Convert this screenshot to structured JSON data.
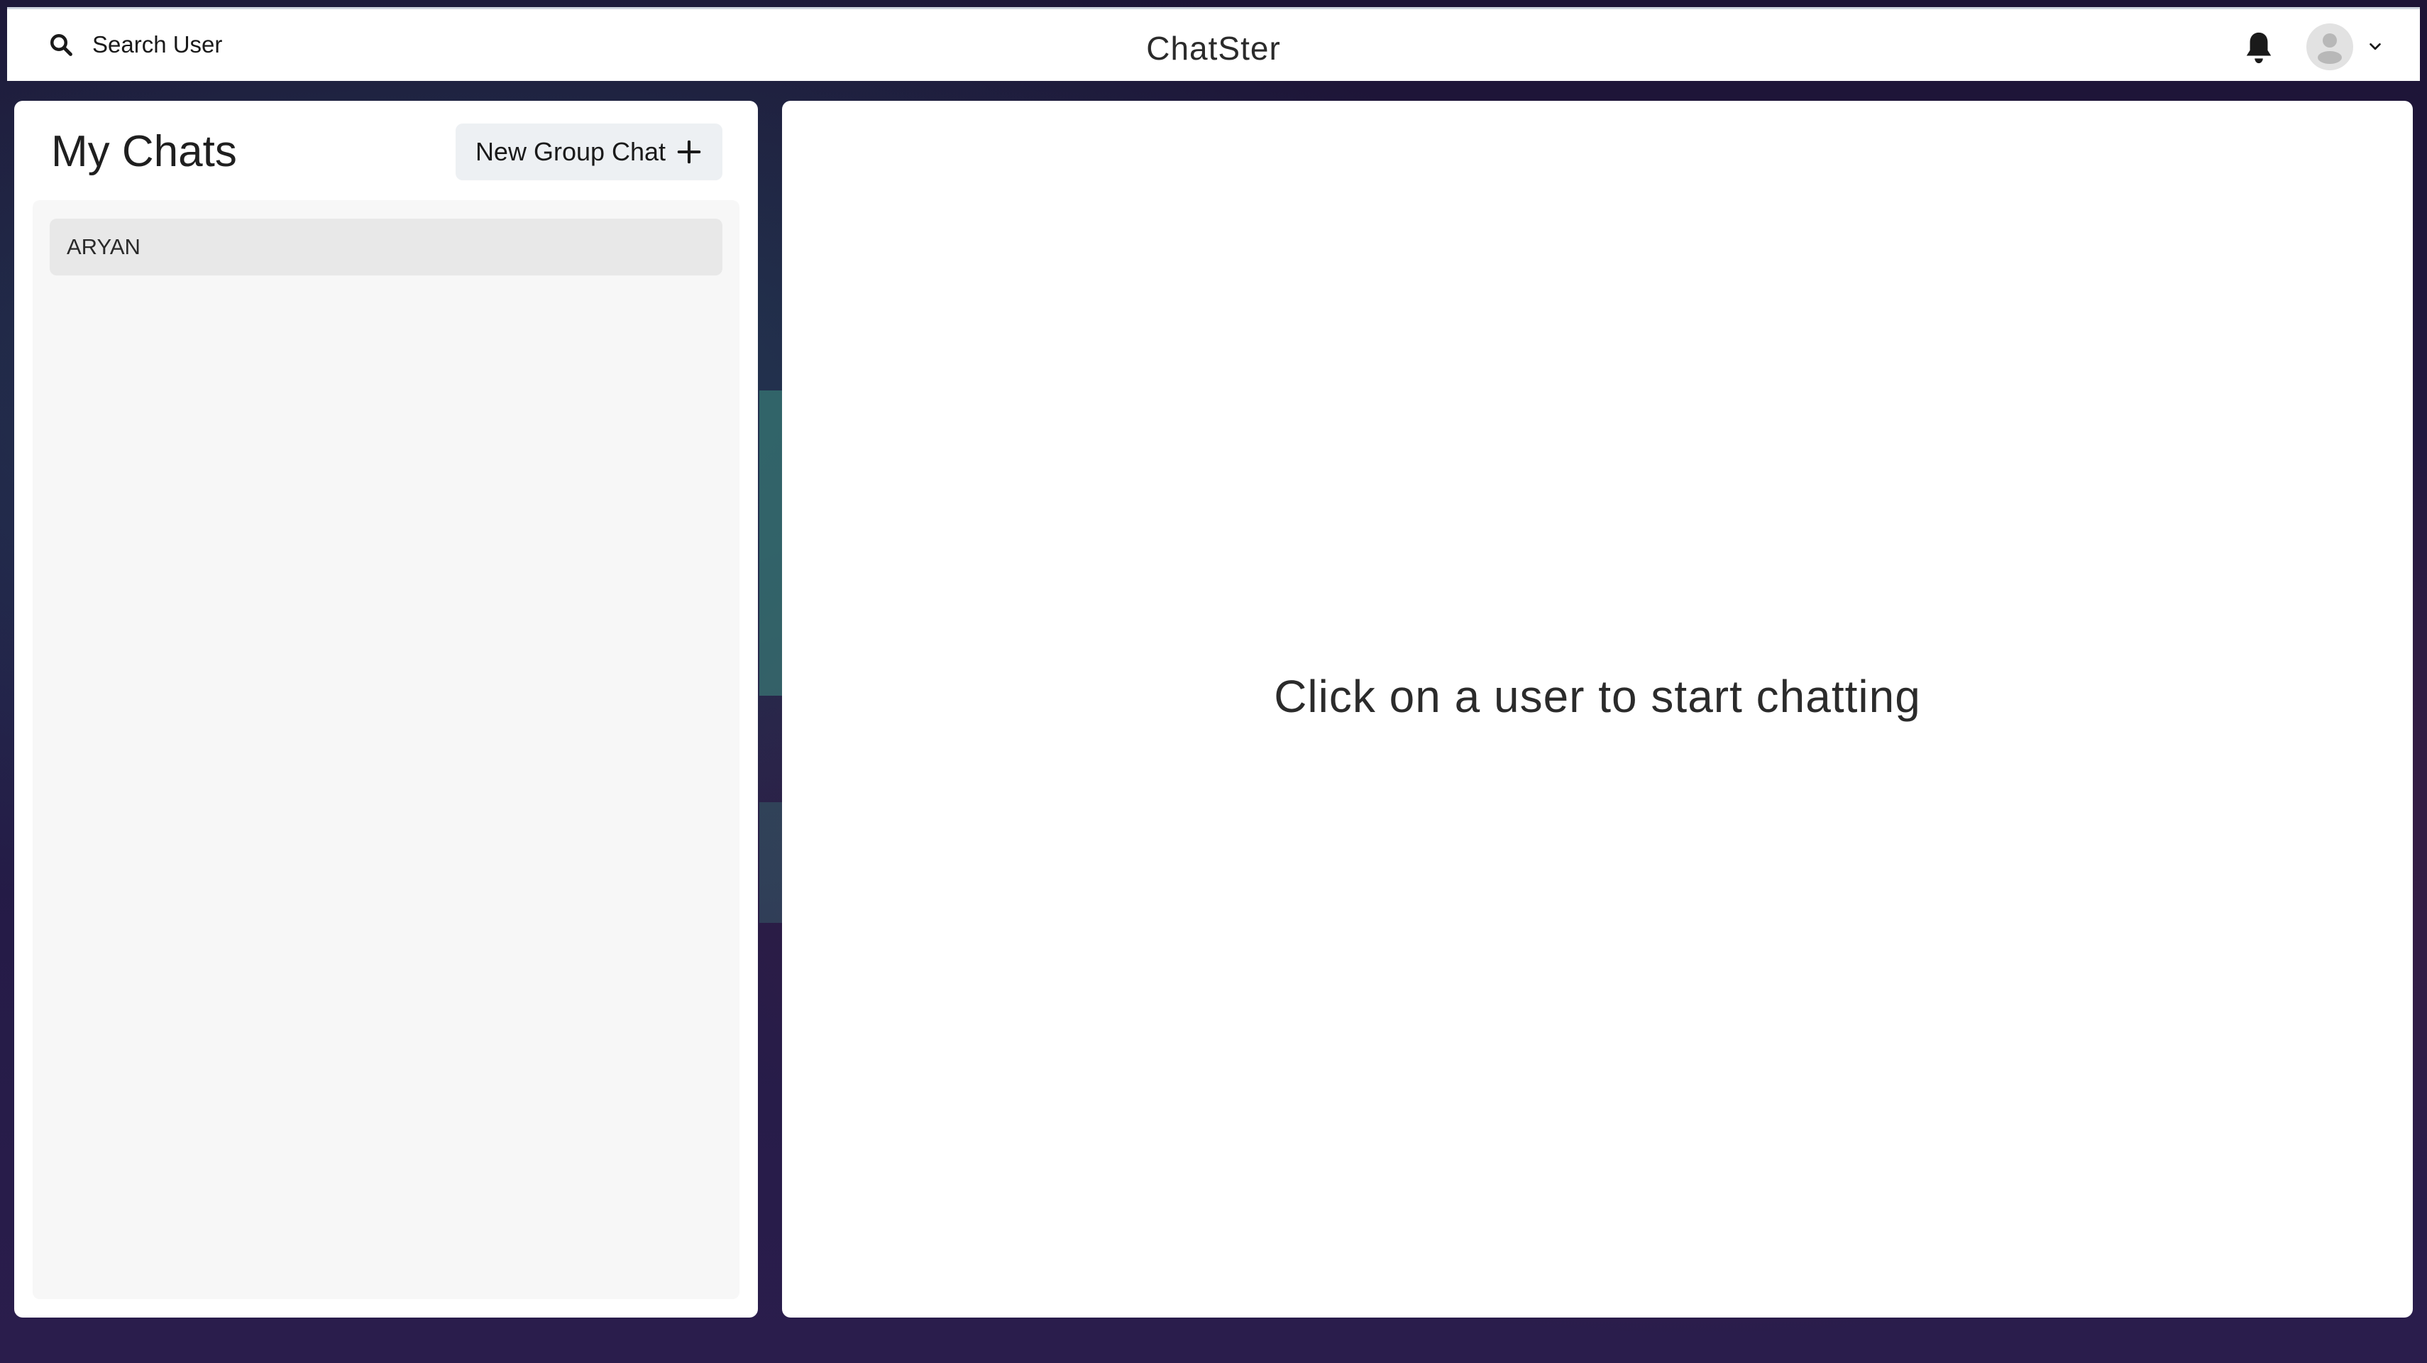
{
  "header": {
    "search_label": "Search User",
    "app_title": "ChatSter",
    "notification_icon": "bell-icon",
    "avatar_icon": "user-avatar-icon",
    "menu_icon": "chevron-down-icon"
  },
  "sidebar": {
    "title": "My Chats",
    "new_group_label": "New Group Chat",
    "new_group_icon": "plus-icon",
    "chats": [
      {
        "name": "ARYAN"
      }
    ]
  },
  "main": {
    "empty_message": "Click on a user to start chatting"
  },
  "colors": {
    "panel_bg": "#ffffff",
    "list_bg": "#f7f7f7",
    "selected_item_bg": "#e8e8e8",
    "button_bg": "#edf0f3",
    "text": "#1a1a1a"
  }
}
